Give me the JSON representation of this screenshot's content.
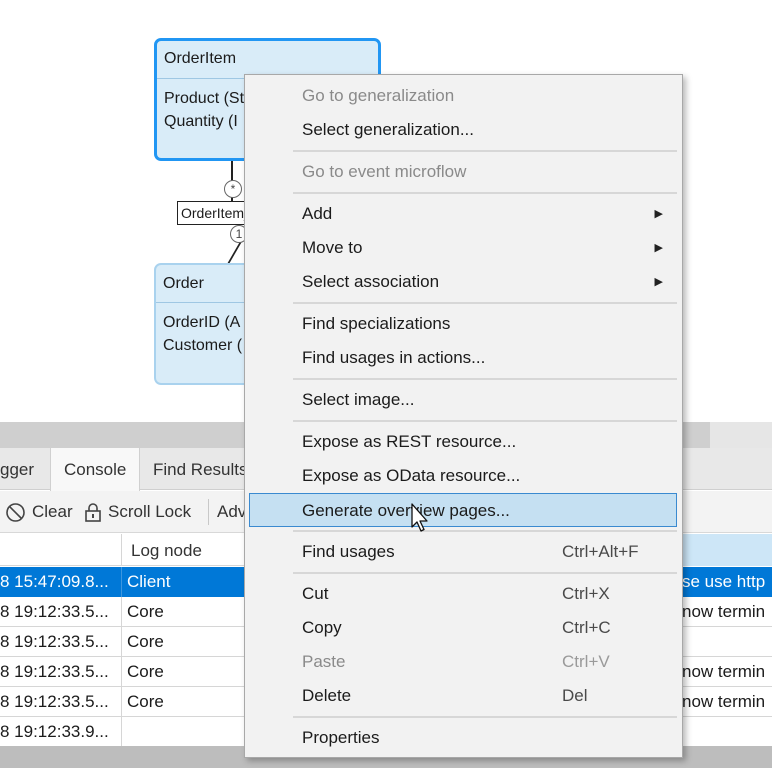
{
  "canvas": {
    "entity_orderitem": {
      "name": "OrderItem",
      "attrs": [
        "Product (St",
        "Quantity (I"
      ]
    },
    "entity_order": {
      "name": "Order",
      "attrs": [
        "OrderID (A",
        "Customer ("
      ]
    },
    "association": {
      "label": "OrderItem_",
      "mult_top": "*",
      "mult_bottom": "1"
    }
  },
  "panel": {
    "tabs": [
      "gger",
      "Console",
      "Find Results"
    ],
    "toolbar": {
      "clear": "Clear",
      "scroll_lock": "Scroll Lock",
      "advanced": "Adv"
    },
    "table": {
      "header_lognode": "Log node",
      "rows": [
        {
          "time": "8 15:47:09.8...",
          "node": "Client",
          "msg": "se use http",
          "selected": true
        },
        {
          "time": "8 19:12:33.5...",
          "node": "Core",
          "msg": "now termin",
          "selected": false
        },
        {
          "time": "8 19:12:33.5...",
          "node": "Core",
          "msg": "",
          "selected": false
        },
        {
          "time": "8 19:12:33.5...",
          "node": "Core",
          "msg": "now termin",
          "selected": false
        },
        {
          "time": "8 19:12:33.5...",
          "node": "Core",
          "msg": "now termin",
          "selected": false
        },
        {
          "time": "8 19:12:33.9...",
          "node": "",
          "msg": "",
          "selected": false
        }
      ]
    }
  },
  "menu": {
    "go_to_generalization": "Go to generalization",
    "select_generalization": "Select generalization...",
    "go_to_event_microflow": "Go to event microflow",
    "add": "Add",
    "move_to": "Move to",
    "select_association": "Select association",
    "find_specializations": "Find specializations",
    "find_usages_in_actions": "Find usages in actions...",
    "select_image": "Select image...",
    "expose_rest": "Expose as REST resource...",
    "expose_odata": "Expose as OData resource...",
    "generate_overview": "Generate overview pages...",
    "find_usages": "Find usages",
    "find_usages_shortcut": "Ctrl+Alt+F",
    "cut": "Cut",
    "cut_shortcut": "Ctrl+X",
    "copy": "Copy",
    "copy_shortcut": "Ctrl+C",
    "paste": "Paste",
    "paste_shortcut": "Ctrl+V",
    "delete": "Delete",
    "delete_shortcut": "Del",
    "properties": "Properties"
  }
}
